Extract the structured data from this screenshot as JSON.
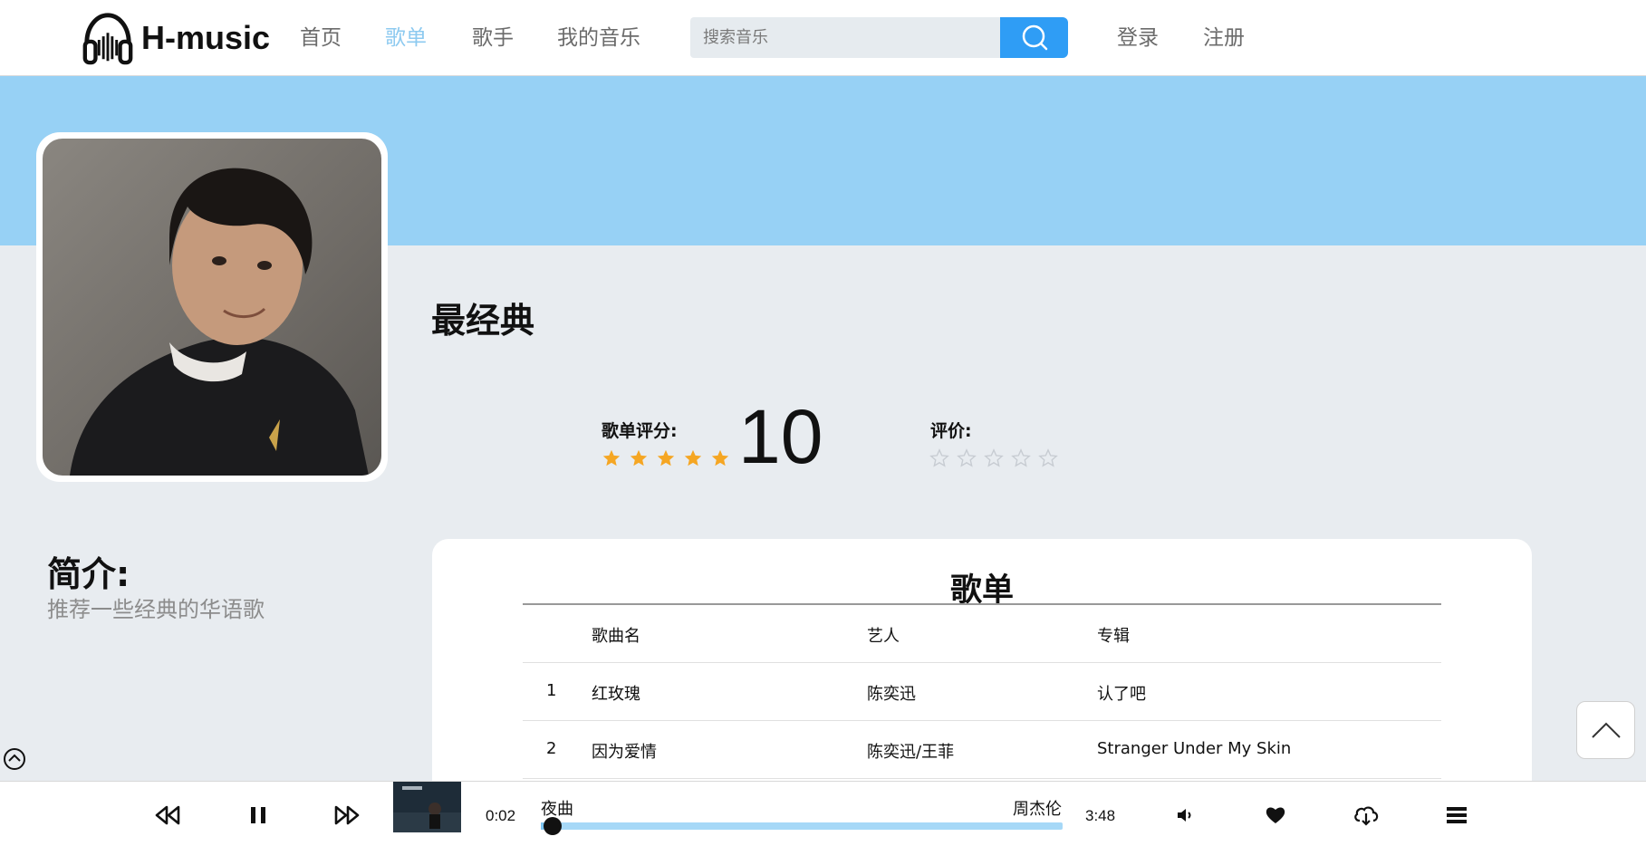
{
  "header": {
    "logo_text": "H-music",
    "nav": [
      {
        "label": "首页",
        "active": false
      },
      {
        "label": "歌单",
        "active": true
      },
      {
        "label": "歌手",
        "active": false
      },
      {
        "label": "我的音乐",
        "active": false
      }
    ],
    "search_placeholder": "搜索音乐",
    "login_label": "登录",
    "register_label": "注册"
  },
  "playlist": {
    "title": "最经典",
    "rating_label": "歌单评分:",
    "rating_stars": 5,
    "score": "10",
    "review_label": "评价:",
    "review_stars": 0,
    "intro_title": "简介:",
    "intro_text": "推荐一些经典的华语歌"
  },
  "songs": {
    "panel_title": "歌单",
    "headers": {
      "name": "歌曲名",
      "artist": "艺人",
      "album": "专辑"
    },
    "rows": [
      {
        "no": "1",
        "name": "红玫瑰",
        "artist": "陈奕迅",
        "album": "认了吧"
      },
      {
        "no": "2",
        "name": "因为爱情",
        "artist": "陈奕迅/王菲",
        "album": "Stranger Under My Skin"
      }
    ]
  },
  "player": {
    "current_time": "0:02",
    "total_time": "3:48",
    "song_name": "夜曲",
    "artist": "周杰伦",
    "progress": 0.01
  },
  "colors": {
    "accent": "#2f9df5",
    "banner": "#97d1f5",
    "nav_active": "#8dcaf0",
    "star_filled": "#f5a623",
    "star_empty": "#c7ccd2"
  },
  "icons": {
    "logo": "headphones-icon",
    "search": "search-icon",
    "back_to_top": "chevron-up-icon",
    "collapse": "chevron-up-circle-icon",
    "prev": "rewind-icon",
    "play_state": "pause-icon",
    "next": "fast-forward-icon",
    "volume": "volume-icon",
    "like": "heart-icon",
    "download": "cloud-download-icon",
    "playlist": "menu-icon"
  }
}
